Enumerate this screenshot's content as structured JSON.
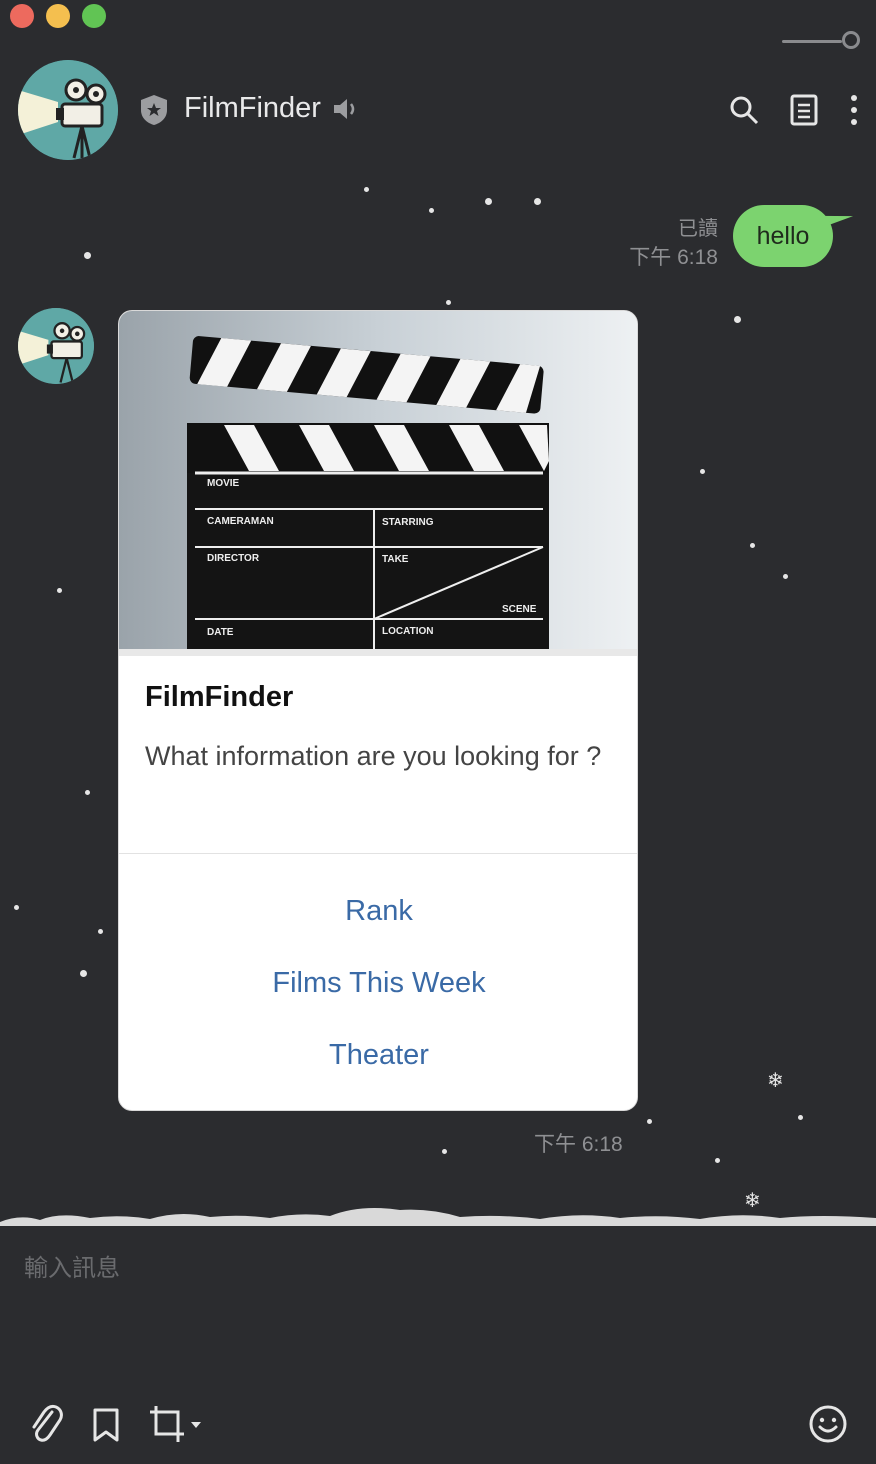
{
  "header": {
    "title": "FilmFinder"
  },
  "messages": {
    "outgoing": {
      "read_status": "已讀",
      "time": "下午 6:18",
      "text": "hello"
    },
    "incoming": {
      "card": {
        "title": "FilmFinder",
        "text": "What information are you looking for ?",
        "actions": [
          "Rank",
          "Films This Week",
          "Theater"
        ],
        "hero": {
          "board_labels": [
            "MOVIE",
            "CAMERAMAN",
            "STARRING",
            "DIRECTOR",
            "TAKE",
            "SCENE",
            "DATE",
            "LOCATION"
          ]
        }
      },
      "time": "下午 6:18"
    }
  },
  "composer": {
    "placeholder": "輸入訊息"
  },
  "colors": {
    "background": "#2b2c2f",
    "bubble": "#7cd36f",
    "action_link": "#3a6aa6"
  }
}
